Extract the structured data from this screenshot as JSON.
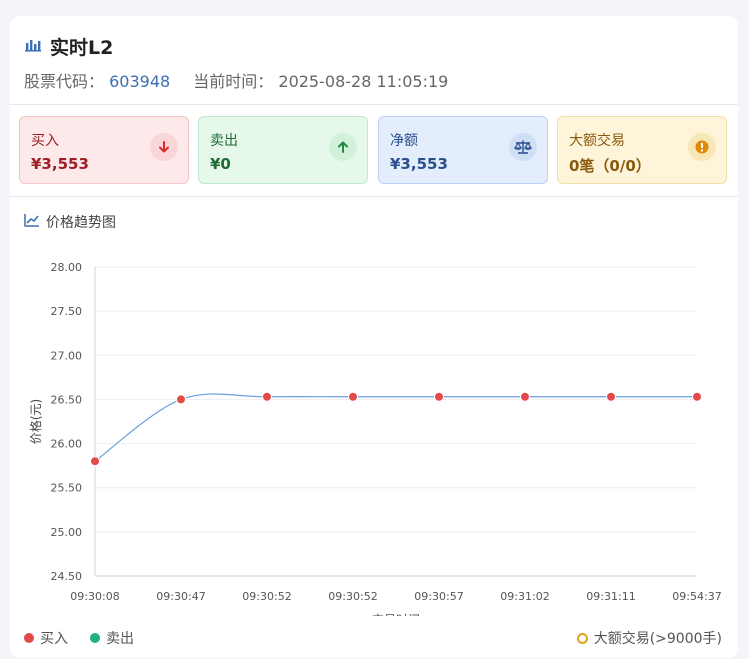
{
  "header": {
    "title": "实时L2",
    "code_label": "股票代码：",
    "code": "603948",
    "time_label": "当前时间：",
    "time": "2025-08-28 11:05:19"
  },
  "stats": {
    "buy": {
      "label": "买入",
      "value": "¥3,553",
      "icon": "arrow-down-icon"
    },
    "sell": {
      "label": "卖出",
      "value": "¥0",
      "icon": "arrow-up-icon"
    },
    "net": {
      "label": "净额",
      "value": "¥3,553",
      "icon": "scale-icon"
    },
    "big": {
      "label": "大额交易",
      "value": "0笔（0/0）",
      "icon": "alert-icon"
    }
  },
  "section_title": "价格趋势图",
  "colors": {
    "buy": "#e24a4a",
    "sell": "#1fb27a",
    "line": "#6c9ee0",
    "big_trade": "#e0a21a",
    "grid": "#eceef1",
    "tick": "#555555"
  },
  "chart_data": {
    "type": "line",
    "title": "",
    "xlabel": "交易时间",
    "ylabel": "价格(元)",
    "ylim": [
      24.5,
      28.0
    ],
    "yticks": [
      "24.50",
      "25.00",
      "25.50",
      "26.00",
      "26.50",
      "27.00",
      "27.50",
      "28.00"
    ],
    "categories": [
      "09:30:08",
      "09:30:47",
      "09:30:52",
      "09:30:52",
      "09:30:57",
      "09:31:02",
      "09:31:11",
      "09:54:37"
    ],
    "series": [
      {
        "name": "买入",
        "values": [
          25.8,
          26.5,
          26.53,
          26.53,
          26.53,
          26.53,
          26.53,
          26.53
        ]
      }
    ],
    "grid": true,
    "legend": [
      {
        "name": "买入",
        "marker": "dot",
        "color": "#e24a4a"
      },
      {
        "name": "卖出",
        "marker": "dot",
        "color": "#1fb27a"
      },
      {
        "name": "大额交易(>9000手)",
        "marker": "ring",
        "color": "#e0a21a"
      }
    ],
    "legend_position": "bottom"
  }
}
